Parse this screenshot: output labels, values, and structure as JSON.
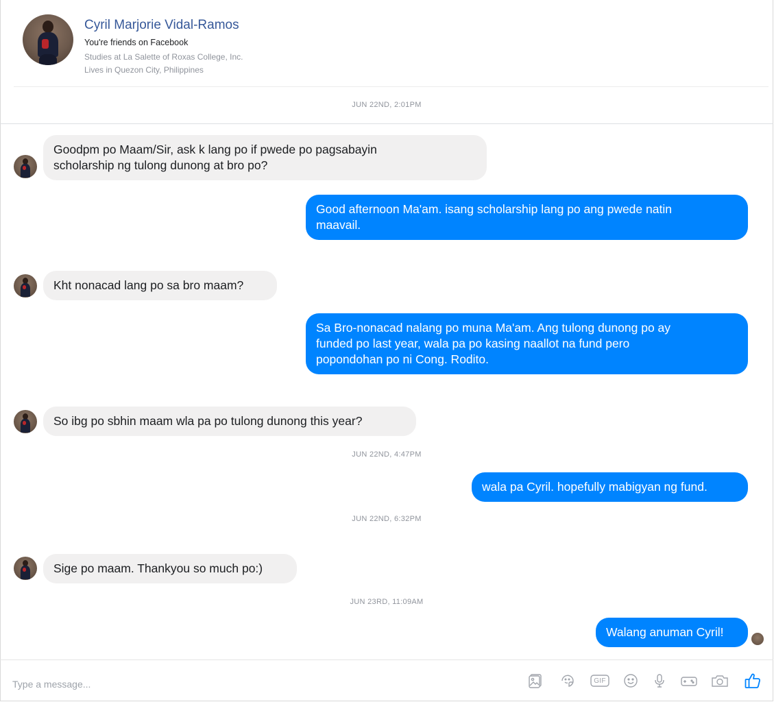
{
  "profile": {
    "name": "Cyril Marjorie Vidal-Ramos",
    "friend_status": "You're friends on Facebook",
    "studies": "Studies at La Salette of Roxas College, Inc.",
    "lives": "Lives in Quezon City, Philippines"
  },
  "timestamps": [
    "JUN 22ND, 2:01PM",
    "JUN 22ND, 4:47PM",
    "JUN 22ND, 6:32PM",
    "JUN 23RD, 11:09AM"
  ],
  "messages": [
    {
      "from": "contact",
      "text": "Goodpm po Maam/Sir, ask k lang po if pwede po pagsabayin\nscholarship ng tulong dunong at bro po?"
    },
    {
      "from": "me",
      "text": "Good afternoon Ma'am. isang scholarship lang po ang pwede natin\nmaavail."
    },
    {
      "from": "contact",
      "text": "Kht nonacad lang po sa bro maam?"
    },
    {
      "from": "me",
      "text": "Sa Bro-nonacad nalang po muna Ma'am. Ang tulong dunong po ay\nfunded po last year, wala pa po kasing naallot na fund pero\npopondohan po ni Cong. Rodito."
    },
    {
      "from": "contact",
      "text": "So ibg po sbhin maam wla pa po tulong dunong this year?"
    },
    {
      "from": "me",
      "text": "wala pa Cyril. hopefully mabigyan ng fund."
    },
    {
      "from": "contact",
      "text": "Sige po maam. Thankyou so much po:)"
    },
    {
      "from": "me",
      "text": "Walang anuman Cyril!"
    }
  ],
  "composer": {
    "placeholder": "Type a message...",
    "tools": [
      "photo-icon",
      "sticker-icon",
      "gif-icon",
      "emoji-icon",
      "microphone-icon",
      "game-icon",
      "camera-icon",
      "like-icon"
    ],
    "gif_label": "GIF"
  },
  "colors": {
    "outgoing_bubble": "#0084ff",
    "incoming_bubble": "#f1f0f0",
    "name_link": "#365899",
    "meta_text": "#90949c"
  }
}
